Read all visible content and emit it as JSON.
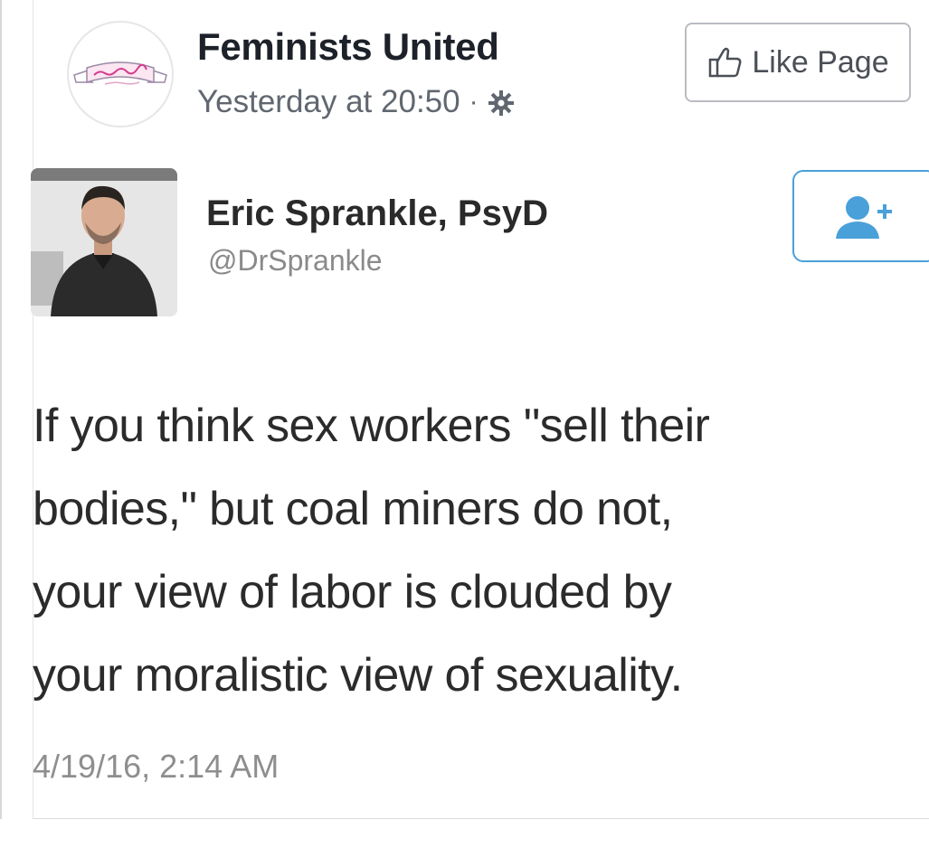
{
  "post": {
    "page_name": "Feminists United",
    "timestamp": "Yesterday at 20:50",
    "separator": "·",
    "like_button_label": "Like Page",
    "avatar_logo_text": "Feminists United"
  },
  "tweet": {
    "author_name": "Eric Sprankle, PsyD",
    "handle": "@DrSprankle",
    "text_lines": [
      "If you think sex workers \"sell their",
      "bodies,\" but coal miners do not,",
      "your view of labor is clouded by",
      "your moralistic view of sexuality."
    ],
    "date": "4/19/16, 2:14 AM"
  },
  "icons": {
    "privacy": "gear-icon",
    "like": "thumbs-up-icon",
    "follow": "add-user-icon"
  },
  "colors": {
    "twitter_blue": "#4aa0d8",
    "fb_meta_gray": "#616770",
    "logo_pink": "#d63a8c"
  }
}
